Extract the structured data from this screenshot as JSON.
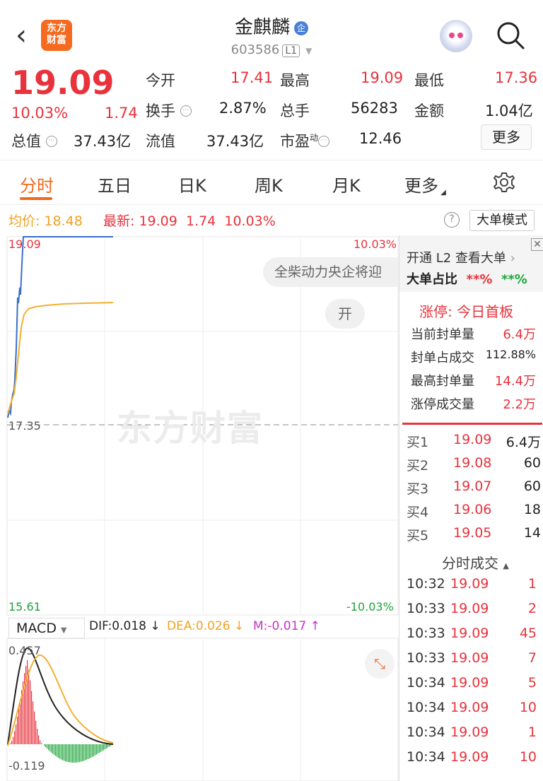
{
  "header": {
    "logo_text_1": "东方",
    "logo_text_2": "财富",
    "stock_name": "金麒麟",
    "company_badge": "企",
    "stock_code": "603586",
    "level_badge": "L1",
    "icons": [
      "back-arrow-icon",
      "search-icon",
      "robot-assistant-icon"
    ]
  },
  "quote": {
    "price": "19.09",
    "change_pct": "10.03%",
    "change": "1.74",
    "open_label": "今开",
    "open": "17.41",
    "high_label": "最高",
    "high": "19.09",
    "low_label": "最低",
    "low": "17.36",
    "turnover_label": "换手",
    "turnover": "2.87%",
    "volume_label": "总手",
    "volume": "56283",
    "amount_label": "金额",
    "amount": "1.04亿",
    "mktcap_label": "总值",
    "mktcap": "37.43亿",
    "float_label": "流值",
    "float": "37.43亿",
    "pe_label": "市盈",
    "pe_sup": "动",
    "pe": "12.46",
    "more_button": "更多"
  },
  "tabs": [
    "分时",
    "五日",
    "日K",
    "周K",
    "月K",
    "更多"
  ],
  "info_line": {
    "avg_label": "均价:",
    "avg": "18.48",
    "latest_label": "最新:",
    "latest": "19.09",
    "change": "1.74",
    "change_pct": "10.03%",
    "mode_button": "大单模式"
  },
  "chart": {
    "price_high": "19.09",
    "price_mid": "17.35",
    "price_low": "15.61",
    "pct_high": "10.03%",
    "pct_low": "-10.03%",
    "news_ticker": "全柴动力央企将迎",
    "open_bubble": "开",
    "watermark": "东方财富",
    "macd": {
      "indicator": "MACD",
      "dif": "DIF:0.018 ↓",
      "dea": "DEA:0.026 ↓",
      "m": "M:-0.017 ↑",
      "max": "0.457",
      "min": "-0.119"
    }
  },
  "right_panel": {
    "l2_promo": "开通 L2 查看大单",
    "big_order_label": "大单占比",
    "big_buy": "**%",
    "big_sell": "**%",
    "limit_up_title": "涨停: 今日首板",
    "seal_rows": [
      {
        "label": "当前封单量",
        "value": "6.4万"
      },
      {
        "label": "封单占成交",
        "value": "112.88%"
      },
      {
        "label": "最高封单量",
        "value": "14.4万"
      },
      {
        "label": "涨停成交量",
        "value": "2.2万"
      }
    ],
    "bids": [
      {
        "label": "买1",
        "price": "19.09",
        "vol": "6.4万"
      },
      {
        "label": "买2",
        "price": "19.08",
        "vol": "60"
      },
      {
        "label": "买3",
        "price": "19.07",
        "vol": "60"
      },
      {
        "label": "买4",
        "price": "19.06",
        "vol": "18"
      },
      {
        "label": "买5",
        "price": "19.05",
        "vol": "14"
      }
    ],
    "trades_title": "分时成交",
    "trades": [
      {
        "time": "10:32",
        "price": "19.09",
        "vol": "1"
      },
      {
        "time": "10:33",
        "price": "19.09",
        "vol": "2"
      },
      {
        "time": "10:33",
        "price": "19.09",
        "vol": "45"
      },
      {
        "time": "10:33",
        "price": "19.09",
        "vol": "7"
      },
      {
        "time": "10:34",
        "price": "19.09",
        "vol": "5"
      },
      {
        "time": "10:34",
        "price": "19.09",
        "vol": "10"
      },
      {
        "time": "10:34",
        "price": "19.09",
        "vol": "1"
      },
      {
        "time": "10:34",
        "price": "19.09",
        "vol": "10"
      }
    ]
  },
  "colors": {
    "up": "#e8323c",
    "down": "#1fa53a",
    "accent": "#ef6a1e",
    "price_line": "#3a6fc9",
    "avg_line": "#f2b030"
  }
}
